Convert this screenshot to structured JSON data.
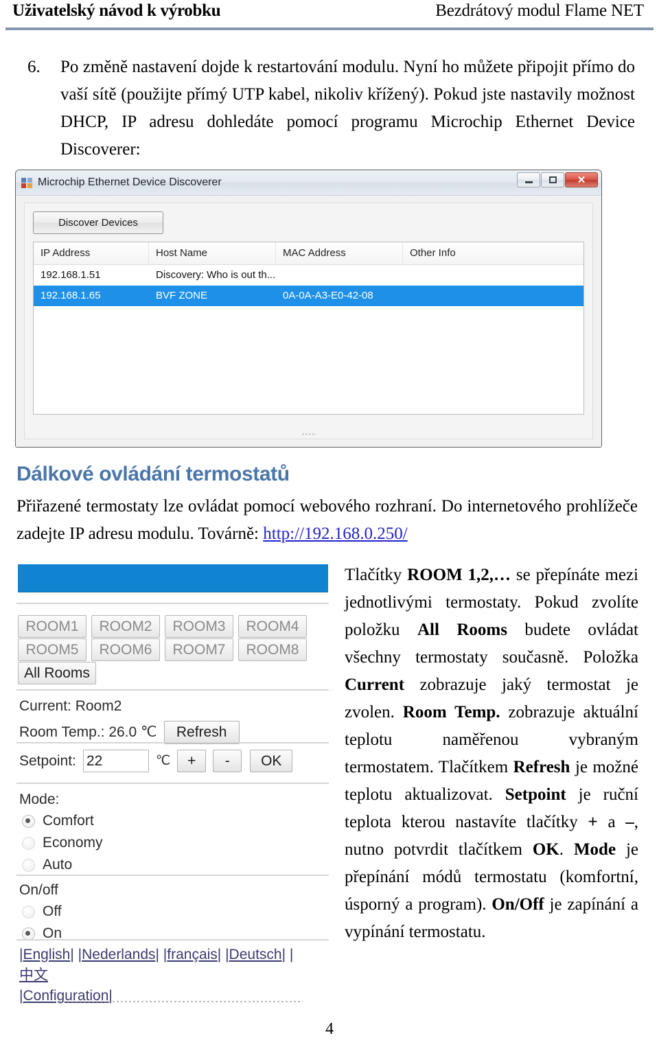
{
  "header": {
    "left_title": "Uživatelský návod k výrobku",
    "right_title": "Bezdrátový modul Flame NET"
  },
  "step": {
    "number": "6.",
    "text": "Po změně nastavení dojde k restartování modulu. Nyní ho můžete připojit přímo do vaší sítě (použijte přímý UTP kabel, nikoliv křížený). Pokud jste nastavily možnost DHCP, IP adresu dohledáte pomocí programu Microchip Ethernet Device Discoverer:"
  },
  "discoverer_window": {
    "title": "Microchip Ethernet Device Discoverer",
    "minimize_label": "Minimize",
    "maximize_label": "Maximize",
    "close_label": "✕",
    "discover_button": "Discover Devices",
    "columns": [
      "IP Address",
      "Host Name",
      "MAC Address",
      "Other Info"
    ],
    "rows": [
      {
        "ip": "192.168.1.51",
        "host": "Discovery: Who is out th...",
        "mac": "",
        "other": "",
        "selected": false
      },
      {
        "ip": "192.168.1.65",
        "host": "BVF ZONE",
        "mac": "0A-0A-A3-E0-42-08",
        "other": "",
        "selected": true
      }
    ],
    "selection_color": "#1e90e8"
  },
  "section": {
    "heading": "Dálkové ovládání termostatů",
    "heading_color": "#4a76a8",
    "paragraph_before": "Přiřazené termostaty lze ovládat pomocí webového rozhraní. Do internetového prohlížeče zadejte IP adresu modulu. Továrně: ",
    "link_text": "http://192.168.0.250/",
    "link_color": "#2222cc"
  },
  "webui": {
    "banner_color": "#1084d0",
    "room_buttons_row1": [
      "ROOM1",
      "ROOM2",
      "ROOM3",
      "ROOM4"
    ],
    "room_buttons_row2": [
      "ROOM5",
      "ROOM6",
      "ROOM7",
      "ROOM8"
    ],
    "all_rooms_button": "All Rooms",
    "current_label": "Current: Room2",
    "room_temp_label": "Room Temp.: 26.0 ℃",
    "refresh_button": "Refresh",
    "setpoint_label": "Setpoint:",
    "setpoint_value": "22",
    "setpoint_unit": "℃",
    "plus_button": "+",
    "minus_button": "-",
    "ok_button": "OK",
    "mode_label": "Mode:",
    "mode_options": [
      {
        "label": "Comfort",
        "selected": true
      },
      {
        "label": "Economy",
        "selected": false
      },
      {
        "label": "Auto",
        "selected": false
      }
    ],
    "onoff_label": "On/off",
    "onoff_options": [
      {
        "label": "Off",
        "selected": false
      },
      {
        "label": "On",
        "selected": true
      }
    ],
    "languages": [
      "English",
      "Nederlands",
      "français",
      "Deutsch",
      "中文"
    ],
    "configuration_link": "Configuration"
  },
  "explanation": {
    "p1a": "Tlačítky ",
    "b1": "ROOM 1,2,…",
    "p1b": " se přepínáte mezi jednotlivými termostaty. Pokud zvolíte položku ",
    "b2": "All Rooms",
    "p1c": " budete ovládat všechny termostaty současně. Položka ",
    "b3": "Current",
    "p1d": " zobrazuje jaký termostat je zvolen. ",
    "b4": "Room Temp.",
    "p1e": " zobrazuje aktuální teplotu naměřenou vybraným termostatem. Tlačítkem ",
    "b5": "Refresh",
    "p1f": " je možné teplotu aktualizovat. ",
    "b6": "Setpoint",
    "p1g": " je ruční teplota kterou nastavíte tlačítky ",
    "b7": "+",
    "p1h": " a ",
    "b8": "–",
    "p1i": ", nutno potvrdit tlačítkem ",
    "b9": "OK",
    "p1j": ". ",
    "b10": "Mode",
    "p1k": " je přepínání módů termostatu (komfortní, úsporný a program). ",
    "b11": "On/Off",
    "p1l": " je zapínání a vypínání termostatu."
  },
  "footer": {
    "page_number": "4"
  }
}
